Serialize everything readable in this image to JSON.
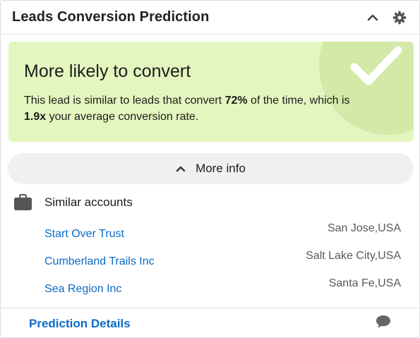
{
  "header": {
    "title": "Leads Conversion Prediction"
  },
  "banner": {
    "heading": "More likely to convert",
    "text_part1": "This lead is similar to leads that convert ",
    "percent": "72%",
    "text_part2": " of the time, which is",
    "multiplier": "1.9x",
    "text_part3": " your average conversion rate.",
    "color_bg": "#e4f6bf"
  },
  "more_info": {
    "label": "More info"
  },
  "similar": {
    "title": "Similar accounts",
    "accounts": [
      {
        "name": "Start Over Trust",
        "location": "San Jose,USA"
      },
      {
        "name": "Cumberland Trails Inc",
        "location": "Salt Lake City,USA"
      },
      {
        "name": "Sea Region Inc",
        "location": "Santa Fe,USA"
      }
    ]
  },
  "footer": {
    "link": "Prediction Details"
  },
  "icons": {
    "collapse": "chevron-up-icon",
    "settings": "gear-icon",
    "check": "checkmark-icon",
    "briefcase": "briefcase-icon",
    "chat": "chat-bubble-icon"
  },
  "colors": {
    "link": "#0b6bc8",
    "banner": "#e4f6bf"
  }
}
